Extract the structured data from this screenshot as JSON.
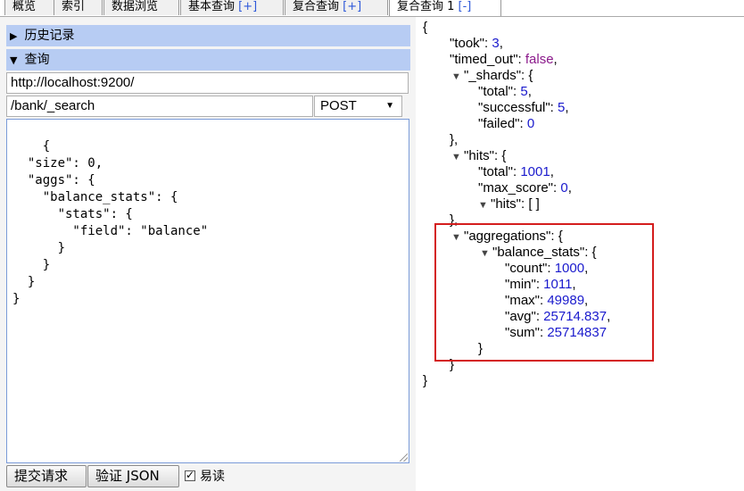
{
  "tabs": [
    {
      "label": "概览",
      "suffix": ""
    },
    {
      "label": "索引",
      "suffix": ""
    },
    {
      "label": "数据浏览",
      "suffix": ""
    },
    {
      "label": "基本查询 ",
      "suffix": "[+]"
    },
    {
      "label": "复合查询 ",
      "suffix": "[+]"
    },
    {
      "label": "复合查询 1 ",
      "suffix": "[-]"
    }
  ],
  "history_label": "历史记录",
  "query_label": "查询",
  "url_value": "http://localhost:9200/",
  "path_value": "/bank/_search",
  "method_selected": "POST",
  "request_body": "{\n  \"size\": 0,\n  \"aggs\": {\n    \"balance_stats\": {\n      \"stats\": {\n        \"field\": \"balance\"\n      }\n    }\n  }\n}",
  "submit_label": "提交请求",
  "validate_label": "验证 JSON",
  "readable_label": "易读",
  "readable_checked": true,
  "response": {
    "took": 3,
    "timed_out": "false",
    "shards": {
      "total": 5,
      "successful": 5,
      "failed": 0
    },
    "hits": {
      "total": 1001,
      "max_score": 0,
      "hits": "[ ]"
    },
    "aggregations": {
      "balance_stats": {
        "count": 1000,
        "min": 1011,
        "max": 49989,
        "avg": "25714.837",
        "sum": 25714837
      }
    }
  },
  "colors": {
    "section_bar": "#b7ccf3",
    "number": "#1a1acd",
    "boolean": "#8b1a8b",
    "highlight": "#d41d1d"
  }
}
